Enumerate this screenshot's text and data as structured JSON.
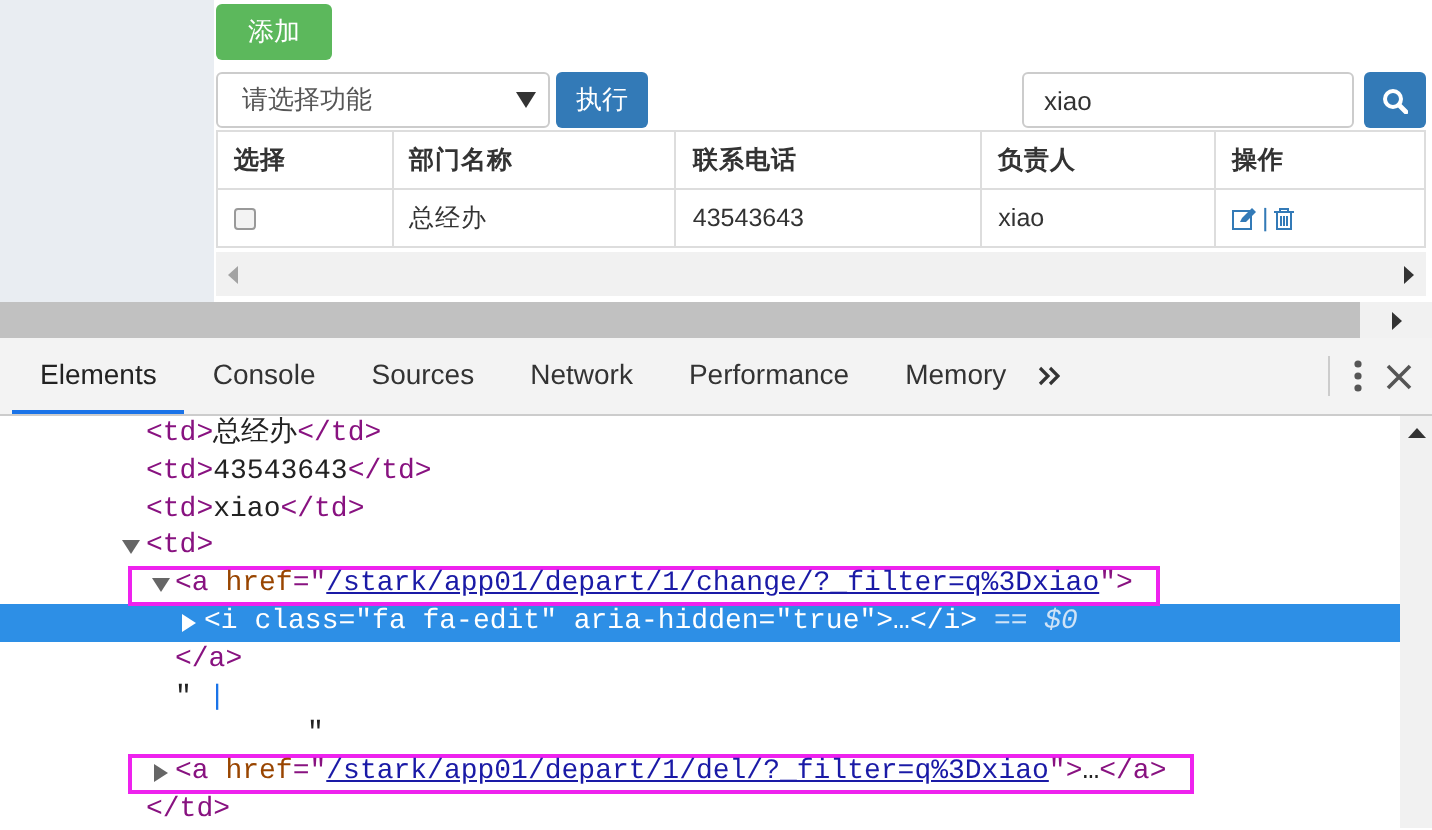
{
  "page": {
    "add_button": "添加",
    "action_select": {
      "value": "请选择功能"
    },
    "execute_button": "执行",
    "search_field": {
      "value": "xiao"
    },
    "table": {
      "columns": [
        "选择",
        "部门名称",
        "联系电话",
        "负责人",
        "操作"
      ],
      "rows": [
        {
          "cells": [
            {
              "kind": "checkbox",
              "checked": false
            },
            {
              "kind": "text",
              "text": "总经办"
            },
            {
              "kind": "text",
              "text": "43543643"
            },
            {
              "kind": "text",
              "text": "xiao"
            },
            {
              "kind": "actions",
              "separator": "|"
            }
          ]
        }
      ]
    }
  },
  "devtools": {
    "tabs": [
      {
        "label": "Elements",
        "selected": true
      },
      {
        "label": "Console",
        "selected": false
      },
      {
        "label": "Sources",
        "selected": false
      },
      {
        "label": "Network",
        "selected": false
      },
      {
        "label": "Performance",
        "selected": false
      },
      {
        "label": "Memory",
        "selected": false
      }
    ],
    "dom_tree": [
      {
        "kind": "leaf",
        "selected": false,
        "tokens": [
          {
            "t": "<td>",
            "kind": "tag"
          },
          {
            "t": "总经办",
            "kind": "text"
          },
          {
            "t": "</td>",
            "kind": "tag"
          }
        ]
      },
      {
        "kind": "leaf",
        "selected": false,
        "tokens": [
          {
            "t": "<td>",
            "kind": "tag"
          },
          {
            "t": "43543643",
            "kind": "text"
          },
          {
            "t": "</td>",
            "kind": "tag"
          }
        ]
      },
      {
        "kind": "leaf",
        "selected": false,
        "tokens": [
          {
            "t": "<td>",
            "kind": "tag"
          },
          {
            "t": "xiao",
            "kind": "text"
          },
          {
            "t": "</td>",
            "kind": "tag"
          }
        ]
      },
      {
        "kind": "element",
        "selected": false,
        "expanded": true,
        "outlined": false,
        "tokens": [
          {
            "t": "<td>",
            "kind": "tag"
          }
        ],
        "closing": [
          {
            "t": "</td>",
            "kind": "tag"
          }
        ],
        "children": [
          {
            "kind": "element",
            "selected": false,
            "expanded": true,
            "outlined": true,
            "tokens": [
              {
                "t": "<a",
                "kind": "tag"
              },
              {
                "t": " href",
                "kind": "attr"
              },
              {
                "t": "=\"",
                "kind": "punct"
              },
              {
                "t": "/stark/app01/depart/1/change/?_filter=q%3Dxiao",
                "kind": "link"
              },
              {
                "t": "\"",
                "kind": "punct"
              },
              {
                "t": ">",
                "kind": "tag"
              }
            ],
            "closing": [
              {
                "t": "</a>",
                "kind": "tag"
              }
            ],
            "children": [
              {
                "kind": "element",
                "selected": true,
                "expanded": false,
                "outlined": false,
                "tokens": [
                  {
                    "t": "<i",
                    "kind": "tag"
                  },
                  {
                    "t": " class",
                    "kind": "attr"
                  },
                  {
                    "t": "=\"",
                    "kind": "punct"
                  },
                  {
                    "t": "fa fa-edit",
                    "kind": "value"
                  },
                  {
                    "t": "\"",
                    "kind": "punct"
                  },
                  {
                    "t": " aria-hidden",
                    "kind": "attr"
                  },
                  {
                    "t": "=\"",
                    "kind": "punct"
                  },
                  {
                    "t": "true",
                    "kind": "value"
                  },
                  {
                    "t": "\"",
                    "kind": "punct"
                  },
                  {
                    "t": ">",
                    "kind": "tag"
                  },
                  {
                    "t": "…",
                    "kind": "text"
                  },
                  {
                    "t": "</i>",
                    "kind": "tag"
                  },
                  {
                    "t": " == $0",
                    "kind": "ref"
                  }
                ]
              }
            ]
          },
          {
            "kind": "text",
            "selected": false,
            "lines": [
              [
                {
                  "t": "\" ",
                  "kind": "text"
                },
                {
                  "t": "|",
                  "kind": "caret"
                }
              ],
              [
                {
                  "t": "\"",
                  "kind": "text"
                }
              ]
            ]
          },
          {
            "kind": "element",
            "selected": false,
            "expanded": false,
            "outlined": true,
            "tokens": [
              {
                "t": "<a",
                "kind": "tag"
              },
              {
                "t": " href",
                "kind": "attr"
              },
              {
                "t": "=\"",
                "kind": "punct"
              },
              {
                "t": "/stark/app01/depart/1/del/?_filter=q%3Dxiao",
                "kind": "link"
              },
              {
                "t": "\"",
                "kind": "punct"
              },
              {
                "t": ">",
                "kind": "tag"
              },
              {
                "t": "…",
                "kind": "text"
              },
              {
                "t": "</a>",
                "kind": "tag"
              }
            ]
          }
        ]
      }
    ]
  }
}
